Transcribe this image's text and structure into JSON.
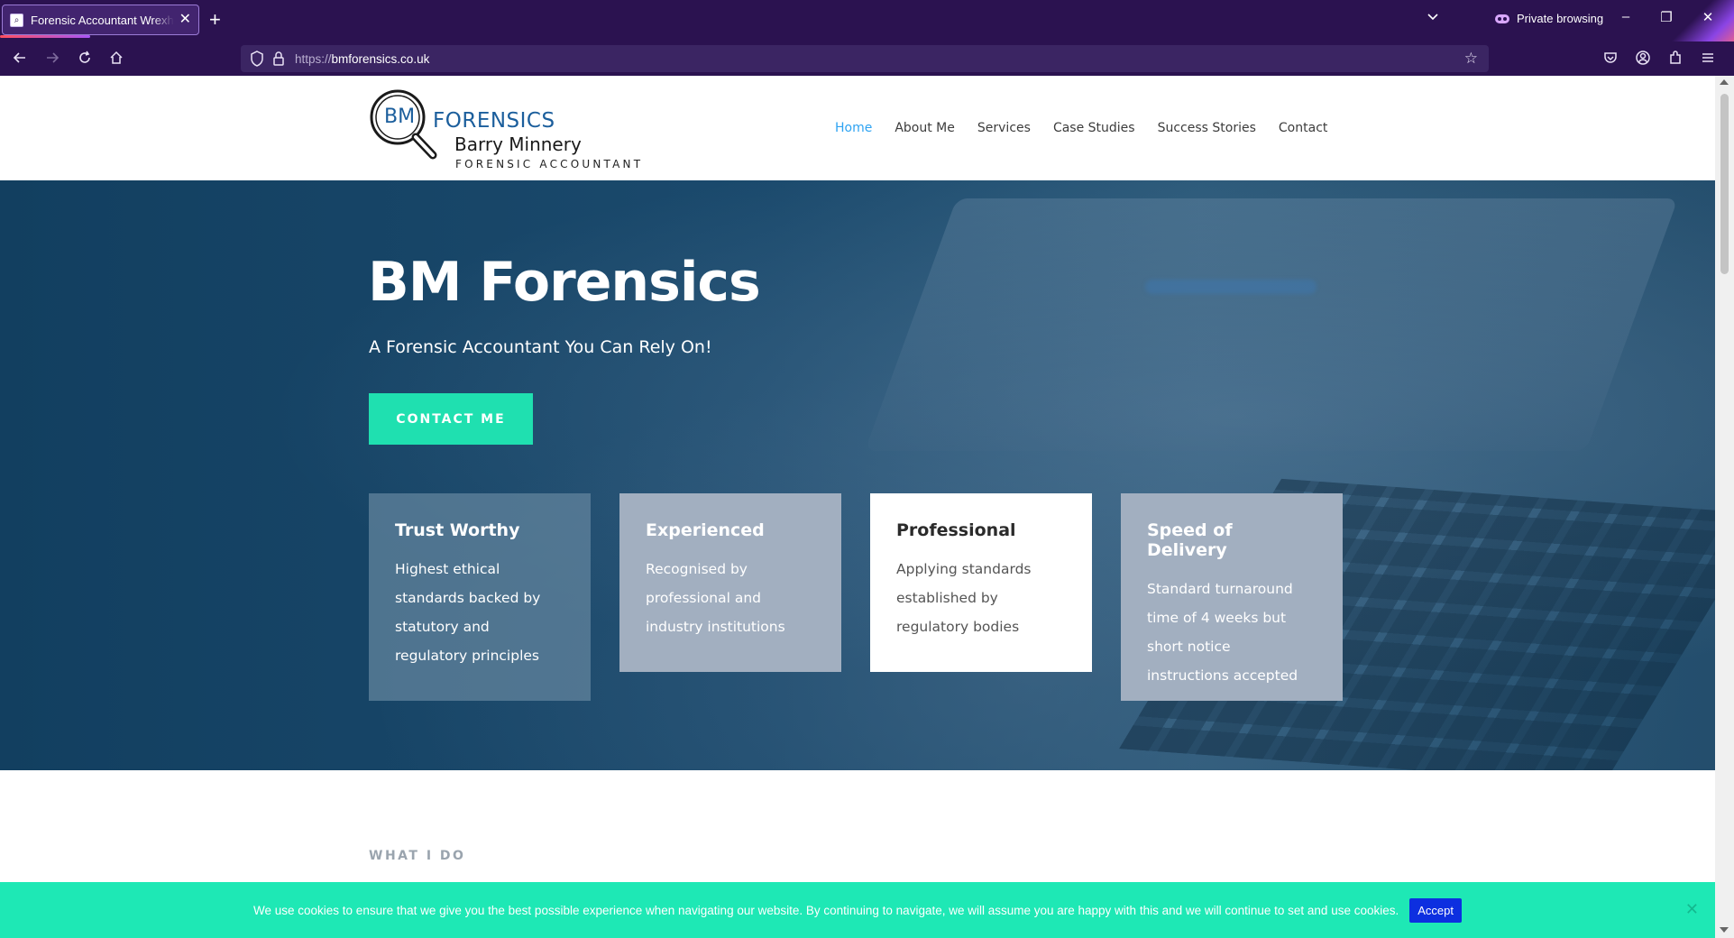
{
  "browser": {
    "tab_title": "Forensic Accountant Wrexham",
    "tab_close": "✕",
    "new_tab": "+",
    "private_label": "Private browsing",
    "url_prefix": "https://",
    "url_domain": "bmforensics.co.uk",
    "icons": [
      "back-icon",
      "forward-icon",
      "reload-icon",
      "home-icon",
      "shield-icon",
      "lock-icon",
      "star-icon",
      "pocket-icon",
      "account-icon",
      "extensions-icon",
      "menu-icon",
      "minimize-icon",
      "restore-icon",
      "close-icon"
    ]
  },
  "site": {
    "logo": {
      "bm": "BM",
      "forensics": "FORENSICS",
      "name": "Barry Minnery",
      "tagline": "FORENSIC ACCOUNTANT"
    },
    "menu": [
      {
        "label": "Home",
        "active": true
      },
      {
        "label": "About Me"
      },
      {
        "label": "Services"
      },
      {
        "label": "Case Studies"
      },
      {
        "label": "Success Stories"
      },
      {
        "label": "Contact"
      }
    ],
    "hero": {
      "title": "BM Forensics",
      "subtitle": "A Forensic Accountant You Can Rely On!",
      "cta": "CONTACT ME"
    },
    "cards": [
      {
        "title": "Trust Worthy",
        "text": "Highest ethical standards backed by statutory and regulatory principles"
      },
      {
        "title": "Experienced",
        "text": "Recognised by professional and industry institutions"
      },
      {
        "title": "Professional",
        "text": "Applying standards established by regulatory bodies"
      },
      {
        "title": "Speed of Delivery",
        "text": "Standard turnaround time of 4 weeks but short notice instructions accepted"
      }
    ],
    "section_label": "WHAT I DO",
    "cookie": {
      "text": "We use cookies to ensure that we give you the best possible experience when navigating our website. By continuing to navigate, we will assume you are happy with this and we will continue to set and use cookies.",
      "accept": "Accept",
      "close": "✕"
    },
    "colors": {
      "accent": "#1fe0b0",
      "menu_active": "#2ea3f2",
      "browser_bg": "#2b1250",
      "accept_button": "#0d2fe0"
    }
  }
}
